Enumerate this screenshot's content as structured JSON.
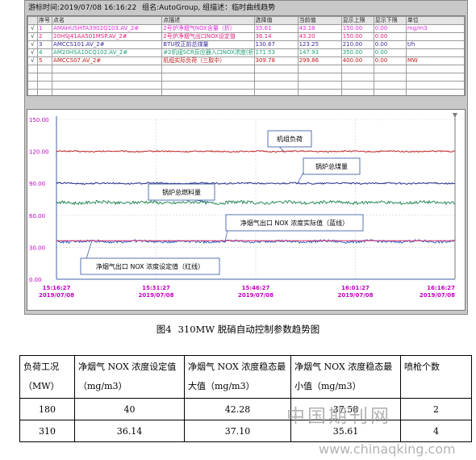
{
  "header": {
    "time_label": "游标时间:",
    "time_value": "2019/07/08 16:16:22",
    "group_label": "组名:",
    "group_value": "AutoGroup,",
    "group_mode": "组描述：临时曲线趋势"
  },
  "pen_table": {
    "columns": [
      "",
      "序号",
      "点名",
      "点描述",
      "选择值",
      "当前值",
      "显示上限",
      "显示下限",
      "单位"
    ],
    "rows": [
      {
        "checked": "√",
        "no": "1",
        "tag": "AMAHUSHTA3902Q103.AV_2#",
        "desc": "2号炉净烟气NOX含量（折）",
        "selected": "35.61",
        "current": "43.18",
        "max": "150.00",
        "min": "0.00",
        "unit": "mg/m3",
        "color": "#e030e0"
      },
      {
        "checked": "√",
        "no": "2",
        "tag": "20HSJ41AA501MSP.AV_2#",
        "desc": "2号炉净烟气出口NOX设定值",
        "selected": "36.14",
        "current": "43.20",
        "max": "150.00",
        "min": "0.00",
        "unit": "",
        "color": "#e0207a"
      },
      {
        "checked": "√",
        "no": "3",
        "tag": "AMCCS101.AV_2#",
        "desc": "BTU校正前总煤量",
        "selected": "130.67",
        "current": "123.25",
        "max": "210.00",
        "min": "0.00",
        "unit": "t/h",
        "color": "#3a2c9a"
      },
      {
        "checked": "√",
        "no": "4",
        "tag": "AM20HSA10CQ102.AV_2#",
        "desc": "#2机组SCR反应器入口NOX浓度(折…",
        "selected": "171.53",
        "current": "147.93",
        "max": "350.00",
        "min": "0.00",
        "unit": "",
        "color": "#20a070"
      },
      {
        "checked": "√",
        "no": "5",
        "tag": "AMCCS07.AV_2#",
        "desc": "机组实际负荷（三取中）",
        "selected": "309.78",
        "current": "299.86",
        "max": "400.00",
        "min": "0.00",
        "unit": "MW",
        "color": "#c01818"
      }
    ]
  },
  "chart_data": {
    "type": "line",
    "y_ticks": [
      "150.00",
      "120.00",
      "90.00",
      "60.00",
      "30.00",
      "0.00"
    ],
    "y_tick_values": [
      150,
      120,
      90,
      60,
      30,
      0
    ],
    "ylim": [
      0,
      150
    ],
    "x_ticks": [
      {
        "time": "15:16:27",
        "date": "2019/07/08"
      },
      {
        "time": "15:31:27",
        "date": "2019/07/08"
      },
      {
        "time": "15:46:27",
        "date": "2019/07/08"
      },
      {
        "time": "16:01:27",
        "date": "2019/07/08"
      },
      {
        "time": "16:16:27",
        "date": "2019/07/08"
      }
    ],
    "x_minutes": [
      0,
      15,
      30,
      45,
      60
    ],
    "series": [
      {
        "name": "机组负荷",
        "color": "#c0282a",
        "base": 120,
        "amp": 0.6,
        "step": 1.5
      },
      {
        "name": "锅炉总煤量",
        "color": "#2a2c8a",
        "base": 90,
        "amp": 0.7,
        "step": 1.5
      },
      {
        "name": "锅炉总燃料量",
        "color": "#2a8a5a",
        "base": 72,
        "amp": 1.4,
        "step": 1.5
      },
      {
        "name": "净烟气出口NOX浓度实际值",
        "color": "#2f5fc0",
        "base": 35.5,
        "amp": 1.2,
        "step": 1.5
      },
      {
        "name": "净烟气出口NOX浓度设定值",
        "color": "#e03070",
        "base": 36.2,
        "amp": 0.0,
        "step": 1.5
      }
    ],
    "grid": true,
    "gridline_color": "#c8d0e0"
  },
  "callouts": {
    "load": "机组负荷",
    "coal": "锅炉总煤量",
    "fuel": "锅炉总燃料量",
    "nox_actual": "净烟气出口 NOX 浓度实际值（蓝线）",
    "nox_set": "净烟气出口 NOX 浓度设定值（红线）"
  },
  "caption": {
    "figure": "图4",
    "title": "310MW 脱硝自动控制参数趋势图"
  },
  "data_table": {
    "headers": [
      "负荷工况（MW）",
      "净烟气 NOX 浓度设定值（mg/m3）",
      "净烟气 NOX 浓度稳态最大值（mg/m3）",
      "净烟气 NOX 浓度稳态最小值（mg/m3）",
      "喷枪个数"
    ],
    "rows": [
      [
        "180",
        "40",
        "42.28",
        "37.58",
        "2"
      ],
      [
        "310",
        "36.14",
        "37.10",
        "35.61",
        "4"
      ]
    ]
  },
  "watermarks": {
    "cn": "中国期刊网",
    "url": "www.chinaqking.com"
  }
}
